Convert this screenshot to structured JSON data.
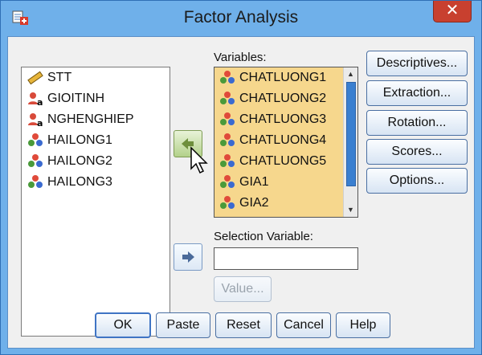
{
  "window": {
    "title": "Factor Analysis",
    "close_label": "✕"
  },
  "source_variables": [
    {
      "label": "STT",
      "icon": "scale-ruler-icon"
    },
    {
      "label": "GIOITINH",
      "icon": "nominal-variable-icon"
    },
    {
      "label": "NGHENGHIEP",
      "icon": "nominal-variable-icon"
    },
    {
      "label": "HAILONG1",
      "icon": "ordinal-variable-icon"
    },
    {
      "label": "HAILONG2",
      "icon": "ordinal-variable-icon"
    },
    {
      "label": "HAILONG3",
      "icon": "ordinal-variable-icon"
    }
  ],
  "variables": {
    "label": "Variables:",
    "items": [
      "CHATLUONG1",
      "CHATLUONG2",
      "CHATLUONG3",
      "CHATLUONG4",
      "CHATLUONG5",
      "GIA1",
      "GIA2"
    ]
  },
  "selection_variable": {
    "label": "Selection Variable:",
    "value": ""
  },
  "value_button": "Value...",
  "side_buttons": [
    "Descriptives...",
    "Extraction...",
    "Rotation...",
    "Scores...",
    "Options..."
  ],
  "bottom_buttons": {
    "ok": "OK",
    "paste": "Paste",
    "reset": "Reset",
    "cancel": "Cancel",
    "help": "Help"
  },
  "colors": {
    "title_bar": "#6fb0ea",
    "selection": "#f6d78d",
    "close_button": "#c8402f"
  }
}
